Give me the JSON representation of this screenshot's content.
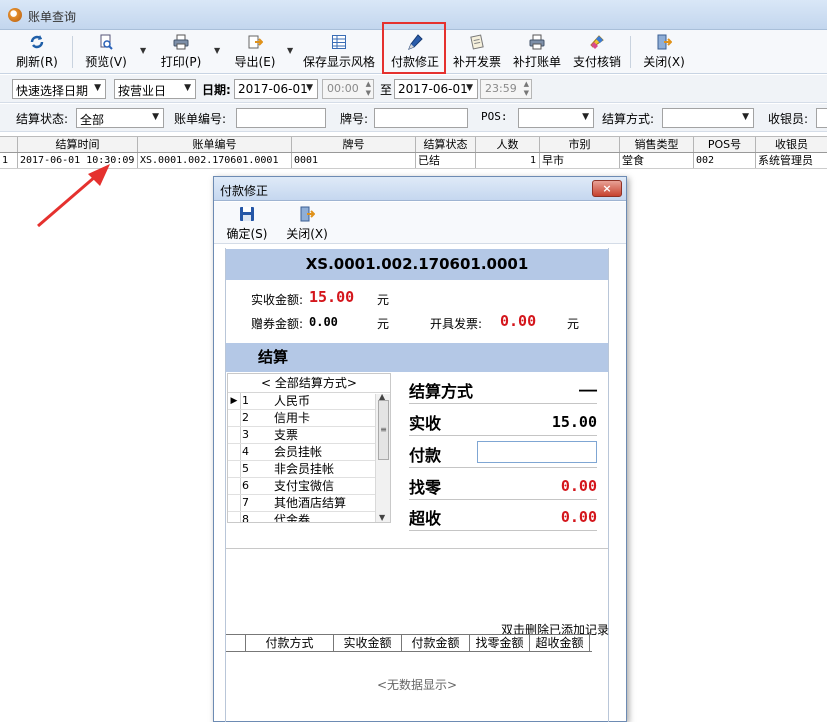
{
  "window": {
    "title": "账单查询"
  },
  "toolbar": {
    "refresh": "刷新(R)",
    "preview": "预览(V)",
    "print": "打印(P)",
    "export": "导出(E)",
    "save_style": "保存显示风格",
    "payment_fix": "付款修正",
    "reissue_invoice": "补开发票",
    "reprint_bill": "补打账单",
    "payment_writeoff": "支付核销",
    "close": "关闭(X)"
  },
  "filters": {
    "quick_date": "快速选择日期",
    "by_business_day": "按营业日",
    "date_label": "日期:",
    "date_from": "2017-06-01",
    "time_from": "00:00",
    "to_label": "至",
    "date_to": "2017-06-01",
    "time_to": "23:59",
    "status_label": "结算状态:",
    "status_value": "全部",
    "bill_no_label": "账单编号:",
    "bill_no_value": "",
    "plate_label": "牌号:",
    "plate_value": "",
    "pos_label": "POS:",
    "pos_value": "",
    "pay_method_label": "结算方式:",
    "pay_method_value": "",
    "cashier_label": "收银员:",
    "cashier_value": ""
  },
  "grid": {
    "columns": [
      "结算时间",
      "账单编号",
      "牌号",
      "结算状态",
      "人数",
      "市别",
      "销售类型",
      "POS号",
      "收银员"
    ],
    "rows": [
      {
        "index": "1",
        "time": "2017-06-01 10:30:09",
        "bill_no": "XS.0001.002.170601.0001",
        "plate": "0001",
        "status": "已结",
        "people": "1",
        "market": "早市",
        "sale_type": "堂食",
        "pos": "002",
        "cashier": "系统管理员"
      }
    ]
  },
  "dialog": {
    "title": "付款修正",
    "close_x": "×",
    "confirm": "确定(S)",
    "close": "关闭(X)",
    "bill_no": "XS.0001.002.170601.0001",
    "received_label": "实收金额:",
    "received_value": "15.00",
    "coupon_label": "赠券金额:",
    "coupon_value": "0.00",
    "invoice_label": "开具发票:",
    "invoice_value": "0.00",
    "currency": "元",
    "section_title": "结算",
    "methods_header": "< 全部结算方式>",
    "methods": [
      {
        "no": "1",
        "name": "人民币"
      },
      {
        "no": "2",
        "name": "信用卡"
      },
      {
        "no": "3",
        "name": "支票"
      },
      {
        "no": "4",
        "name": "会员挂帐"
      },
      {
        "no": "5",
        "name": "非会员挂帐"
      },
      {
        "no": "6",
        "name": "支付宝微信"
      },
      {
        "no": "7",
        "name": "其他酒店结算"
      },
      {
        "no": "8",
        "name": "代金券"
      }
    ],
    "summary": {
      "method_label": "结算方式",
      "method_value": "——",
      "actual_label": "实收",
      "actual_value": "15.00",
      "pay_label": "付款",
      "pay_value": "",
      "change_label": "找零",
      "change_value": "0.00",
      "over_label": "超收",
      "over_value": "0.00"
    },
    "delete_hint": "双击删除已添加记录",
    "sub_columns": [
      "付款方式",
      "实收金额",
      "付款金额",
      "找零金额",
      "超收金额"
    ],
    "no_data": "<无数据显示>"
  },
  "colors": {
    "accent": "#b4c8e6",
    "highlight": "#e5312e",
    "amount_red": "#d4161c"
  }
}
